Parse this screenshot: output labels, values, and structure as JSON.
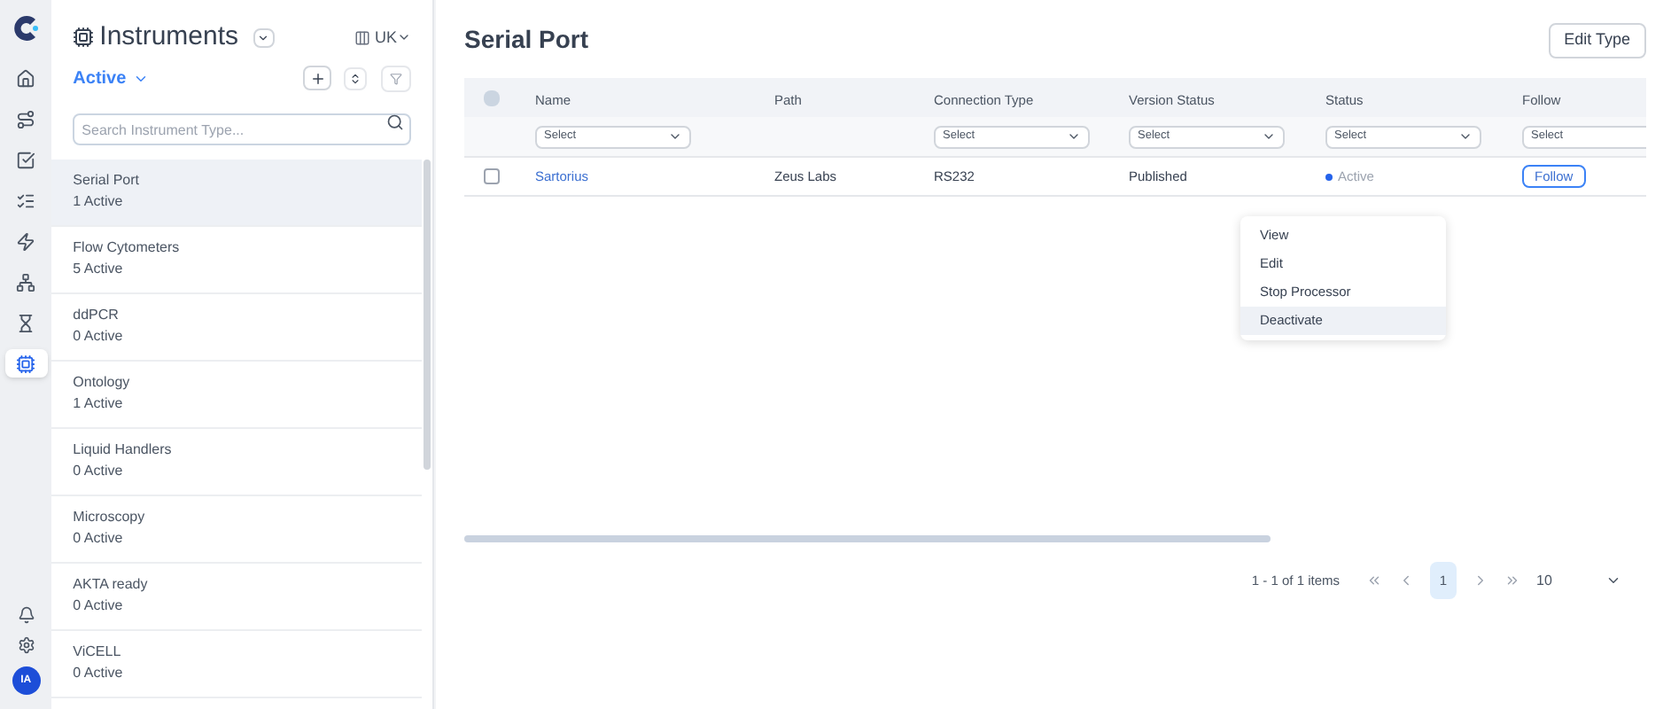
{
  "rail": {
    "items": [
      {
        "kind": "home",
        "selected": false
      },
      {
        "kind": "route",
        "selected": false
      },
      {
        "kind": "check",
        "selected": false
      },
      {
        "kind": "list",
        "selected": false
      },
      {
        "kind": "bolt",
        "selected": false
      },
      {
        "kind": "network",
        "selected": false
      },
      {
        "kind": "hourglass",
        "selected": false
      },
      {
        "kind": "chip",
        "selected": true
      }
    ],
    "bottom": [
      {
        "kind": "bell"
      },
      {
        "kind": "settings"
      }
    ],
    "avatar": "IA"
  },
  "sidebar": {
    "title": "Instruments",
    "region": "UK",
    "filter": "Active",
    "search": {
      "placeholder": "Search Instrument Type..."
    },
    "items": [
      {
        "name": "Serial Port",
        "count": "1 Active",
        "selected": true
      },
      {
        "name": "Flow Cytometers",
        "count": "5 Active",
        "selected": false
      },
      {
        "name": "ddPCR",
        "count": "0 Active",
        "selected": false
      },
      {
        "name": "Ontology",
        "count": "1 Active",
        "selected": false
      },
      {
        "name": "Liquid Handlers",
        "count": "0 Active",
        "selected": false
      },
      {
        "name": "Microscopy",
        "count": "0 Active",
        "selected": false
      },
      {
        "name": "AKTA ready",
        "count": "0 Active",
        "selected": false
      },
      {
        "name": "ViCELL",
        "count": "0 Active",
        "selected": false
      }
    ]
  },
  "main": {
    "title": "Serial Port",
    "edit_button": "Edit Type",
    "table": {
      "select_all": {
        "checked": false
      },
      "columns": [
        {
          "label": "Name",
          "filter": "Select"
        },
        {
          "label": "Path"
        },
        {
          "label": "Connection Type",
          "filter": "Select"
        },
        {
          "label": "Version Status",
          "filter": "Select"
        },
        {
          "label": "Status",
          "filter": "Select"
        },
        {
          "label": "Follow",
          "filter": "Select"
        }
      ],
      "rows": [
        {
          "checked": false,
          "name": "Sartorius",
          "path": "Zeus Labs",
          "connection": "RS232",
          "version": "Published",
          "status": "Active",
          "color": "#2563eb",
          "follow": "Follow"
        }
      ]
    },
    "menu": [
      {
        "label": "View",
        "selected": false
      },
      {
        "label": "Edit",
        "selected": false
      },
      {
        "label": "Stop Processor",
        "selected": false
      },
      {
        "label": "Deactivate",
        "selected": true
      }
    ],
    "pagination": {
      "summary": "1 - 1 of 1 items",
      "pages": [
        {
          "label": "1",
          "selected": true
        }
      ],
      "page_size": "10"
    }
  }
}
